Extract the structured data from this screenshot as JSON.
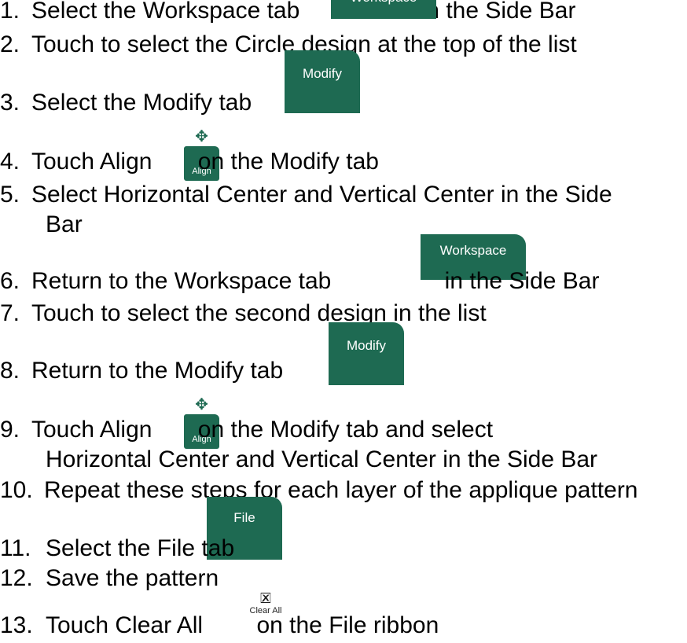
{
  "steps": [
    {
      "num": "1.",
      "before": "Select the Workspace tab",
      "after": "in the Side Bar"
    },
    {
      "num": "2.",
      "text": "Touch to select the Circle design at the top of the list"
    },
    {
      "num": "3.",
      "text": "Select the Modify tab"
    },
    {
      "num": "4.",
      "before": "Touch Align",
      "after": "on the Modify tab"
    },
    {
      "num": "5.",
      "text": "Select Horizontal Center and Vertical Center in the Side",
      "cont": "Bar"
    },
    {
      "num": "6.",
      "before": "Return to the Workspace tab",
      "after": "in the Side Bar"
    },
    {
      "num": "7.",
      "text": "Touch to select the second design in the list"
    },
    {
      "num": "8.",
      "text": "Return to the Modify tab"
    },
    {
      "num": "9.",
      "before": "Touch Align",
      "after": "on the Modify tab and select",
      "cont": "Horizontal Center and Vertical Center in the Side Bar"
    },
    {
      "num": "10.",
      "text": "Repeat these steps for each layer of the applique pattern"
    },
    {
      "num": "11.",
      "text": "Select the File tab"
    },
    {
      "num": "12.",
      "text": "Save the pattern"
    },
    {
      "num": "13.",
      "before": "Touch Clear All",
      "after": "on the File ribbon"
    }
  ],
  "buttons": {
    "workspace": "Workspace",
    "modify": "Modify",
    "align": "Align",
    "file": "File",
    "clear_all": "Clear All"
  },
  "icons": {
    "align": "align-move-icon",
    "clear_all": "clear-all-document-icon"
  },
  "colors": {
    "button_bg": "#1e6a52",
    "button_text": "#ffffff",
    "text": "#000000"
  }
}
